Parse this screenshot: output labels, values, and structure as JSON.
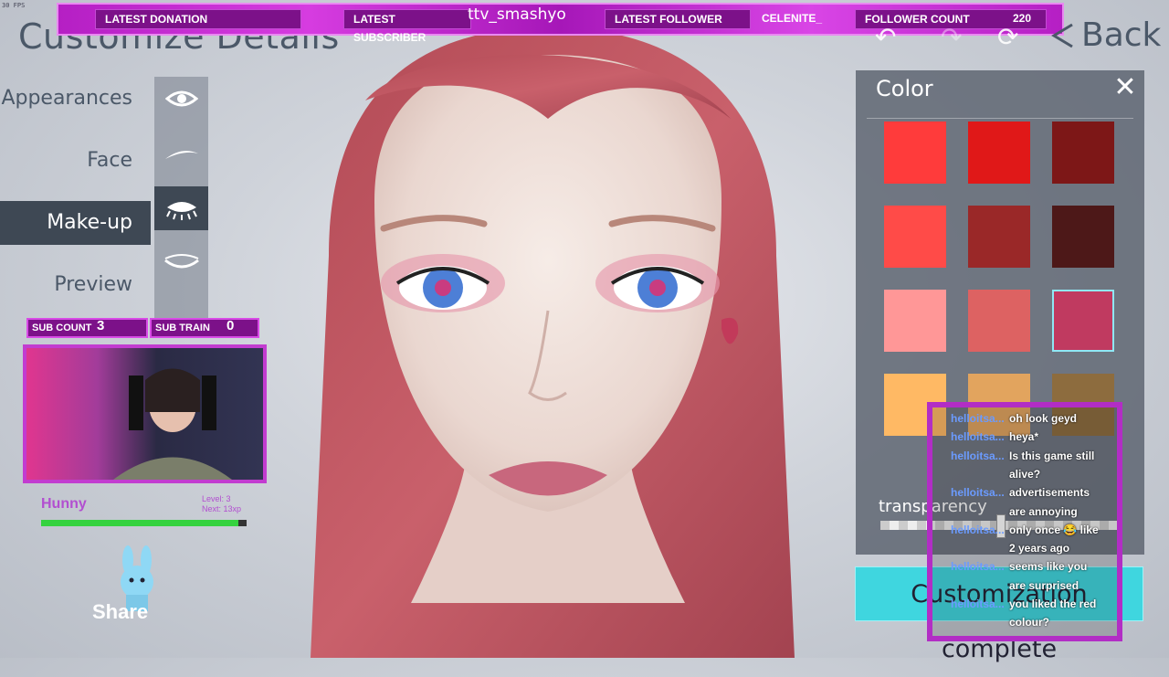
{
  "hud": {
    "fps": "30 FPS"
  },
  "header": {
    "title": "Customize Details",
    "back_label": "Back"
  },
  "nav": {
    "items": [
      {
        "label": "Appearances",
        "active": false
      },
      {
        "label": "Face",
        "active": false
      },
      {
        "label": "Make-up",
        "active": true
      },
      {
        "label": "Preview",
        "active": false
      }
    ]
  },
  "stream_bar": {
    "latest_donation_label": "LATEST DONATION",
    "latest_subscriber_label": "LATEST SUBSCRIBER",
    "latest_subscriber_value": "ttv_smashyo",
    "latest_follower_label": "LATEST FOLLOWER",
    "latest_follower_value": "CELENITE_",
    "follower_count_label": "FOLLOWER COUNT",
    "follower_count_value": "220"
  },
  "color_panel": {
    "title": "Color",
    "swatches": [
      [
        "#ff3b3b",
        "#e01818",
        "#7d1717"
      ],
      [
        "#ff4b48",
        "#9a2828",
        "#4d1818"
      ],
      [
        "#ff9797",
        "#dd6262",
        "#c03a60"
      ],
      [
        "#ffb964",
        "#e2a45e",
        "#8d6c3e"
      ]
    ],
    "selected_swatch": "#c03a60",
    "transparency_label": "transparency",
    "transparency_value": 0.5
  },
  "complete_button": {
    "label": "Customization complete"
  },
  "stream_overlay": {
    "sub_count_label": "SUB COUNT",
    "sub_count_value": "3",
    "sub_train_label": "SUB TRAIN",
    "sub_train_value": "0",
    "name": "Hunny",
    "level": "Level: 3",
    "next": "Next: 13xp",
    "xp_fraction": 0.96,
    "share_label": "Share"
  },
  "chat": {
    "lines": [
      {
        "user": "helloitsa...",
        "msg": "oh look geyd"
      },
      {
        "user": "helloitsa...",
        "msg": "heya*"
      },
      {
        "user": "helloitsa...",
        "msg": "Is this game still"
      },
      {
        "user": "",
        "msg": "alive?"
      },
      {
        "user": "helloitsa...",
        "msg": "advertisements"
      },
      {
        "user": "",
        "msg": "are annoying"
      },
      {
        "user": "helloitsa...",
        "msg": "only once 😂 like"
      },
      {
        "user": "",
        "msg": "2 years ago"
      },
      {
        "user": "helloitsa...",
        "msg": "seems like you"
      },
      {
        "user": "",
        "msg": "are surprised"
      },
      {
        "user": "helloitsa...",
        "msg": "you liked the red"
      },
      {
        "user": "",
        "msg": "colour?"
      }
    ]
  },
  "colors": {
    "accent_magenta": "#c23cd0",
    "cyan": "#3fd6df",
    "panel": "#5a626e"
  }
}
